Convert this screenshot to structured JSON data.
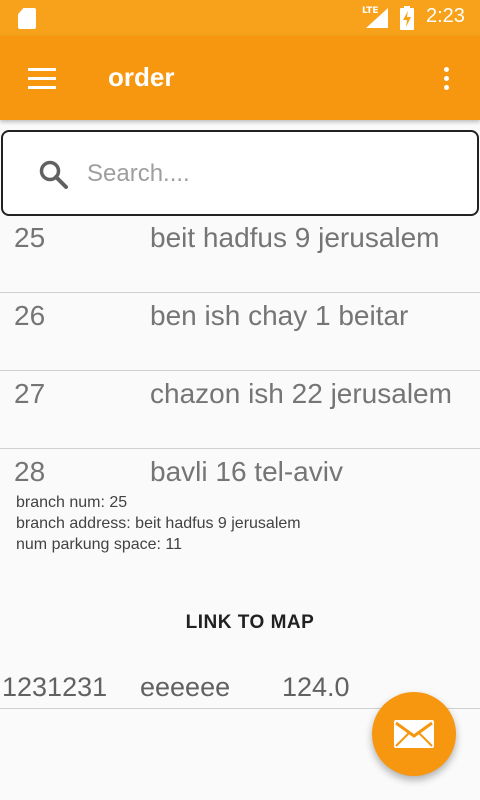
{
  "status_bar": {
    "network_label": "LTE",
    "time": "2:23"
  },
  "toolbar": {
    "title": "order"
  },
  "search": {
    "placeholder": "Search...."
  },
  "branches": [
    {
      "num": "25",
      "address": "beit hadfus 9 jerusalem"
    },
    {
      "num": "26",
      "address": "ben ish chay 1 beitar"
    },
    {
      "num": "27",
      "address": "chazon ish 22 jerusalem"
    },
    {
      "num": "28",
      "address": "bavli 16 tel-aviv"
    }
  ],
  "details": {
    "branch_num": "branch num: 25",
    "branch_address": "branch address: beit hadfus 9 jerusalem",
    "parking": "num parkung space: 11"
  },
  "link_label": "LINK TO MAP",
  "data_row": {
    "col1": "1231231",
    "col2": "eeeeee",
    "col3": "124.0"
  },
  "colors": {
    "status_bar": "#f7a21a",
    "toolbar": "#f7960f",
    "fab": "#f7960f"
  },
  "icons": {
    "menu": "hamburger-menu-icon",
    "overflow": "more-vert-icon",
    "search": "search-icon",
    "fab": "email-icon"
  }
}
